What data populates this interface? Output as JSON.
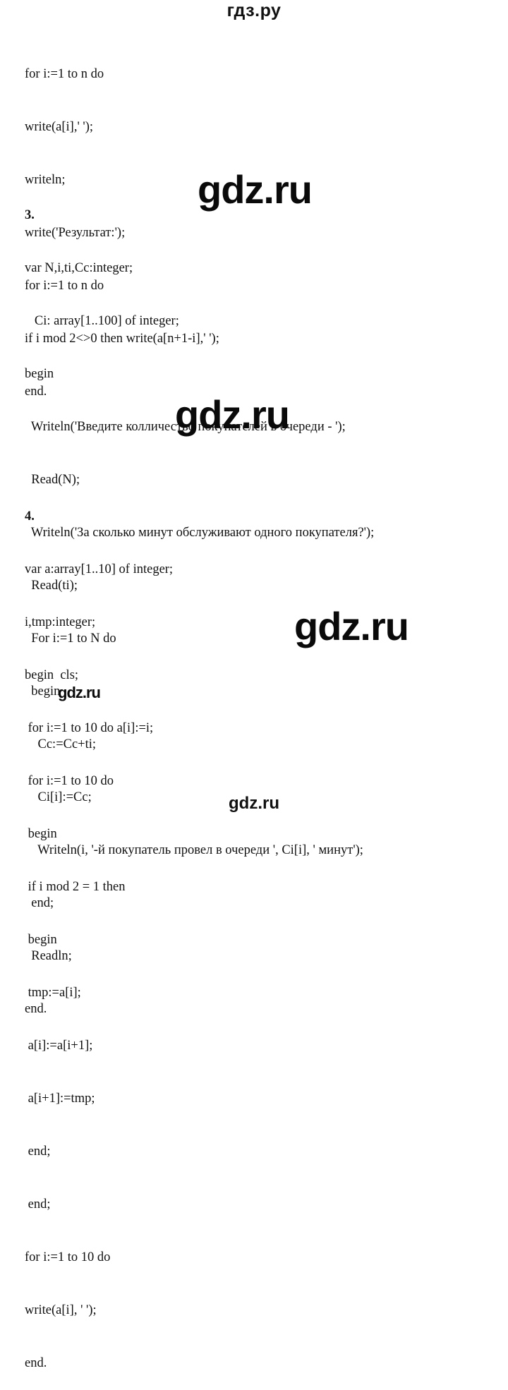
{
  "header": {
    "title": "гдз.ру"
  },
  "section_top": {
    "lines": [
      "for i:=1 to n do",
      "write(a[i],' ');",
      "writeln;",
      "write('Результат:');",
      "for i:=1 to n do",
      "if i mod 2<>0 then write(a[n+1-i],' ');",
      "end."
    ]
  },
  "section_3": {
    "number": "3.",
    "lines": [
      "var N,i,ti,Cc:integer;",
      "   Ci: array[1..100] of integer;",
      "begin",
      "  Writeln('Введите колличество покупателей в очереди - ');",
      "  Read(N);",
      "  Writeln('За сколько минут обслуживают одного покупателя?');",
      "  Read(ti);",
      "  For i:=1 to N do",
      "  begin",
      "    Cc:=Cc+ti;",
      "    Ci[i]:=Cc;",
      "    Writeln(i, '-й покупатель провел в очереди ', Ci[i], ' минут');",
      "  end;",
      "  Readln;",
      "end."
    ]
  },
  "section_4": {
    "number": "4.",
    "lines": [
      "var a:array[1..10] of integer;",
      "i,tmp:integer;",
      "begin  cls;",
      " for i:=1 to 10 do a[i]:=i;",
      " for i:=1 to 10 do",
      " begin",
      " if i mod 2 = 1 then",
      " begin",
      " tmp:=a[i];",
      " a[i]:=a[i+1];",
      " a[i+1]:=tmp;",
      " end;",
      " end;",
      "for i:=1 to 10 do",
      "write(a[i], ' ');",
      "end."
    ]
  },
  "watermarks": [
    "gdz.ru",
    "gdz.ru",
    "gdz.ru",
    "gdz.ru"
  ],
  "footer": {
    "text": "gdz.ru"
  }
}
